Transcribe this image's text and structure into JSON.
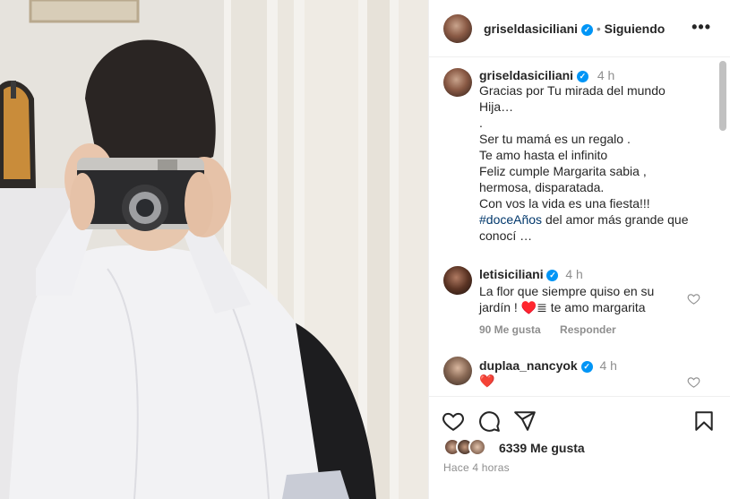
{
  "header": {
    "username": "griseldasiciliani",
    "follow_status": "Siguiendo",
    "more_label": "•••"
  },
  "caption": {
    "username": "griseldasiciliani",
    "time": "4 h",
    "text_before": "Gracias por Tu mirada del mundo\nHija…\n.\nSer tu mamá es un regalo .\nTe amo hasta el infinito\nFeliz cumple Margarita sabia ,\nhermosa, disparatada.\nCon vos la vida es una fiesta!!!\n",
    "hashtag": "#doceAños",
    "text_after": " del amor más grande que\nconocí …"
  },
  "comments": [
    {
      "username": "letisiciliani",
      "time": "4 h",
      "text": "La flor que siempre quiso en su jardín ! ♥️≣ te amo margarita",
      "likes": "90 Me gusta",
      "reply_label": "Responder"
    },
    {
      "username": "duplaa_nancyok",
      "time": "4 h",
      "text": "❤️"
    }
  ],
  "actions": {
    "icons": [
      "heart-icon",
      "comment-icon",
      "share-icon",
      "save-icon"
    ],
    "likes": "6339 Me gusta",
    "timestamp": "Hace 4 horas"
  },
  "colors": {
    "verified": "#0095f6",
    "hashtag": "#00376b",
    "muted": "#8e8e8e",
    "text": "#262626",
    "comment_heart": "#ed4956"
  }
}
